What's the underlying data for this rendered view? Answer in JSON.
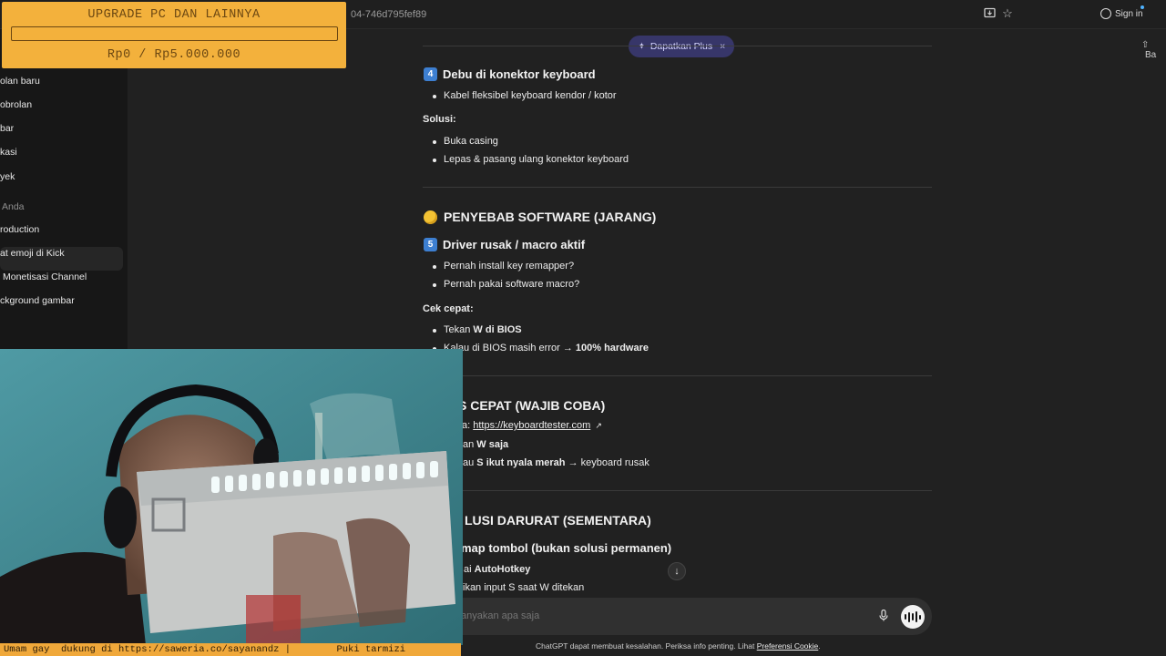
{
  "browser": {
    "url_fragment": "04-746d795fef89",
    "sign_in_label": "Sign in",
    "share_label": "Ba"
  },
  "sidebar": {
    "items": [
      {
        "label": "olan baru"
      },
      {
        "label": "obrolan"
      },
      {
        "label": "bar"
      },
      {
        "label": "kasi"
      },
      {
        "label": "yek"
      }
    ],
    "section_label": "Anda",
    "history": [
      {
        "label": "roduction",
        "active": true
      },
      {
        "label": "at emoji di Kick"
      },
      {
        "label": "Monetisasi Channel"
      },
      {
        "label": "ckground gambar"
      }
    ]
  },
  "header": {
    "upgrade_pill": "Dapatkan Plus"
  },
  "chat": {
    "s4_number": "4",
    "s4_title": "Debu di konektor keyboard",
    "s4_item1": "Kabel fleksibel keyboard kendor / kotor",
    "solusi_label": "Solusi:",
    "solusi_item1": "Buka casing",
    "solusi_item2": "Lepas & pasang ulang konektor keyboard",
    "software_title": "PENYEBAB SOFTWARE (JARANG)",
    "s5_number": "5",
    "s5_title": "Driver rusak / macro aktif",
    "s5_item1": "Pernah install key remapper?",
    "s5_item2": "Pernah pakai software macro?",
    "cek_label": "Cek cepat:",
    "cek_item1_pre": "Tekan ",
    "cek_item1_bold": "W di BIOS",
    "cek_item2_pre": "Kalau di BIOS masih error → ",
    "cek_item2_bold": "100% hardware",
    "test_title": "S CEPAT (WAJIB COBA)",
    "test_item1_pre": "a: ",
    "test_item1_link": "https://keyboardtester.com",
    "test_item1_icon": "↗",
    "test_item2_pre": "an ",
    "test_item2_bold": "W saja",
    "test_item3_pre": "au ",
    "test_item3_bold": "S ikut nyala merah",
    "test_item3_post": " → keyboard rusak",
    "darurat_title": "LUSI DARURAT (SEMENTARA)",
    "darurat_sub": "map tombol (bukan solusi permanen)",
    "darurat_item1_pre": "ai ",
    "darurat_item1_bold": "AutoHotkey",
    "darurat_item2": "ikan input S saat W ditekan"
  },
  "composer": {
    "placeholder": "anyakan apa saja"
  },
  "footer": {
    "disclaimer": "ChatGPT dapat membuat kesalahan. Periksa info penting. Lihat ",
    "disclaimer_link": "Preferensi Cookie",
    "disclaimer_end": "."
  },
  "donation": {
    "title": "UPGRADE PC DAN LAINNYA",
    "amount": "Rp0 / Rp5.000.000",
    "progress_fraction": 0
  },
  "ticker": {
    "text": "Umam gay  dukung di https://saweria.co/sayanandz |        Puki tarmizi"
  },
  "icons": {
    "scroll_down": "arrow-down-icon",
    "mic": "mic-icon",
    "voice": "voice-mode-icon"
  },
  "colors": {
    "background": "#212121",
    "sidebar": "#171717",
    "accent_pill": "#373669",
    "donation_bg": "#f3b13c",
    "number_badge": "#3d7fd1"
  }
}
